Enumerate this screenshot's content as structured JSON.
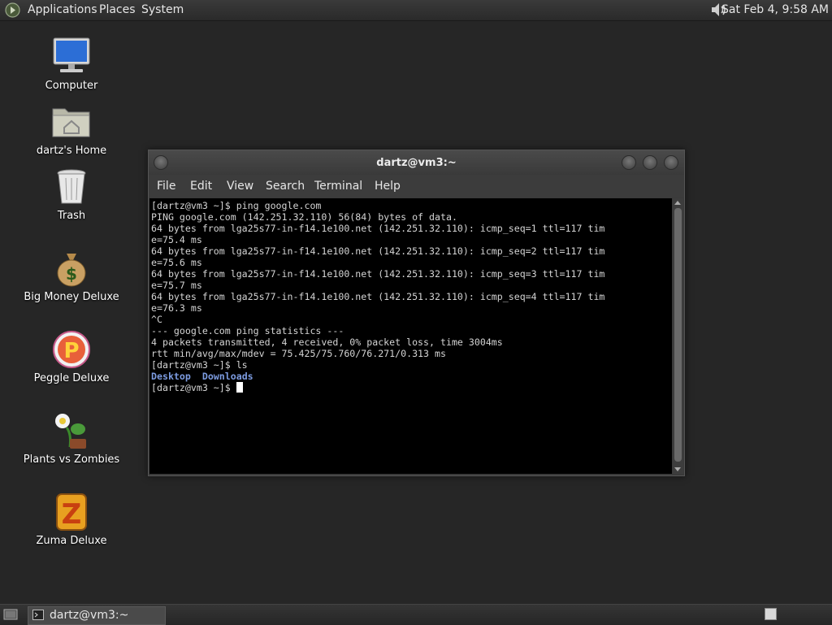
{
  "top_panel": {
    "menus": [
      "Applications",
      "Places",
      "System"
    ],
    "clock": "Sat Feb  4,  9:58 AM"
  },
  "desktop_icons": [
    {
      "label": "Computer",
      "icon": "computer-icon"
    },
    {
      "label": "dartz's Home",
      "icon": "home-folder-icon"
    },
    {
      "label": "Trash",
      "icon": "trash-icon"
    },
    {
      "label": "Big Money Deluxe",
      "icon": "money-bag-icon"
    },
    {
      "label": "Peggle Deluxe",
      "icon": "peggle-icon"
    },
    {
      "label": "Plants vs Zombies",
      "icon": "plants-vs-zombies-icon"
    },
    {
      "label": "Zuma Deluxe",
      "icon": "zuma-icon"
    }
  ],
  "window": {
    "title": "dartz@vm3:~",
    "menu": [
      "File",
      "Edit",
      "View",
      "Search",
      "Terminal",
      "Help"
    ],
    "terminal_lines": [
      "[dartz@vm3 ~]$ ping google.com",
      "PING google.com (142.251.32.110) 56(84) bytes of data.",
      "64 bytes from lga25s77-in-f14.1e100.net (142.251.32.110): icmp_seq=1 ttl=117 tim",
      "e=75.4 ms",
      "64 bytes from lga25s77-in-f14.1e100.net (142.251.32.110): icmp_seq=2 ttl=117 tim",
      "e=75.6 ms",
      "64 bytes from lga25s77-in-f14.1e100.net (142.251.32.110): icmp_seq=3 ttl=117 tim",
      "e=75.7 ms",
      "64 bytes from lga25s77-in-f14.1e100.net (142.251.32.110): icmp_seq=4 ttl=117 tim",
      "e=76.3 ms",
      "^C",
      "--- google.com ping statistics ---",
      "4 packets transmitted, 4 received, 0% packet loss, time 3004ms",
      "rtt min/avg/max/mdev = 75.425/75.760/76.271/0.313 ms",
      "[dartz@vm3 ~]$ ls"
    ],
    "ls_output": [
      "Desktop",
      "Downloads"
    ],
    "prompt": "[dartz@vm3 ~]$ "
  },
  "taskbar": {
    "task_label": "dartz@vm3:~"
  },
  "colors": {
    "desktop_bg": "#262626",
    "terminal_bg": "#000000",
    "terminal_fg": "#d4d4d4",
    "directory_color": "#7c9be0"
  }
}
